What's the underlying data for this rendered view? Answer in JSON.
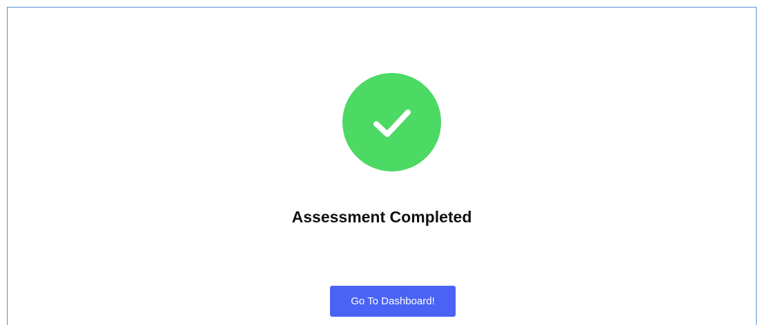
{
  "completion": {
    "icon": "checkmark-icon",
    "title": "Assessment Completed",
    "button_label": "Go To Dashboard!"
  },
  "colors": {
    "success_green": "#4cd964",
    "button_blue": "#4a63f5",
    "frame_border": "#5b8fd6",
    "title_text": "#111111"
  }
}
